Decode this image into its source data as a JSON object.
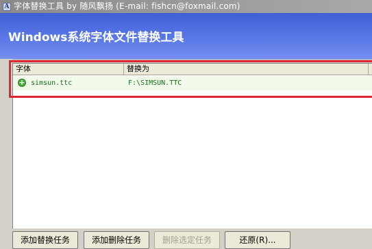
{
  "window": {
    "icon": "app-icon",
    "title": "字体替换工具 by 随风飘扬 (E-mail: fishcn@foxmail.com)"
  },
  "header": {
    "heading": "Windows系统字体文件替换工具"
  },
  "list": {
    "columns": [
      "字体",
      "替换为"
    ],
    "rows": [
      {
        "icon": "add-circle-icon",
        "font": "simsun.ttc",
        "replacement": "F:\\SIMSUN.TTC"
      }
    ]
  },
  "buttons": {
    "add_replace": "添加替换任务",
    "add_delete": "添加删除任务",
    "delete_selected": "删除选定任务",
    "restore": "还原(R)..."
  },
  "colors": {
    "header_blue": "#3f5fd6",
    "highlight_red": "#e0262d",
    "row_green": "#1c6b1c"
  }
}
